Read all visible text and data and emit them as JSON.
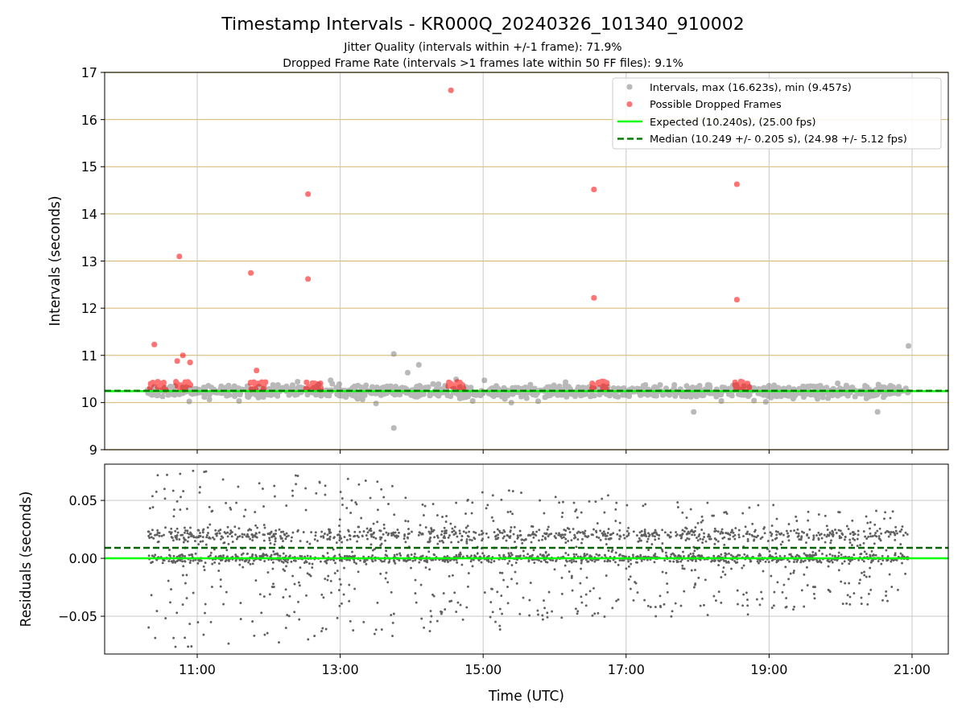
{
  "figure": {
    "title": "Timestamp Intervals - KR000Q_20240326_101340_910002",
    "subtitles": [
      "Jitter Quality (intervals within +/-1 frame): 71.9%",
      "Dropped Frame Rate (intervals >1 frames late within 50 FF files): 9.1%"
    ]
  },
  "charts": [
    {
      "chart_data": {
        "type": "scatter",
        "ylabel": "Intervals (seconds)",
        "xlim": [
          9.705,
          21.507
        ],
        "ylim": [
          9,
          17
        ],
        "yticks": [
          9,
          10,
          11,
          12,
          13,
          14,
          15,
          16,
          17
        ],
        "grid": true,
        "legend": true,
        "series": [
          {
            "name": "Intervals, max (16.623s), min (9.457s)",
            "type": "scatter",
            "color": "#808080",
            "x": [
              13.75,
              13.75,
              20.95,
              14.1
            ],
            "values": [
              11.03,
              9.46,
              11.2,
              10.8
            ]
          },
          {
            "name": "Possible Dropped Frames",
            "type": "scatter",
            "color": "#ff0000",
            "x": [
              10.4,
              10.75,
              11.75,
              12.55,
              12.55,
              14.55,
              16.55,
              16.55,
              18.55,
              18.55,
              10.8,
              10.9,
              10.72,
              11.83
            ],
            "values": [
              11.23,
              13.1,
              12.75,
              14.42,
              12.62,
              16.62,
              14.52,
              12.22,
              14.63,
              12.18,
              11.0,
              10.85,
              10.88,
              10.68
            ]
          },
          {
            "name": "Expected (10.240s), (25.00 fps)",
            "type": "line",
            "line_style": "solid",
            "color": "#00ff00",
            "x": [
              9.705,
              21.507
            ],
            "values": [
              10.24,
              10.24
            ]
          },
          {
            "name": "Median (10.249 +/- 0.205 s), (24.98 +/- 5.12 fps)",
            "type": "line",
            "line_style": "dashed",
            "color": "#008000",
            "x": [
              9.705,
              21.507
            ],
            "values": [
              10.25,
              10.25
            ]
          }
        ]
      }
    },
    {
      "chart_data": {
        "type": "scatter",
        "xlabel": "Time (UTC)",
        "ylabel": "Residuals (seconds)",
        "xlim": [
          9.705,
          21.507
        ],
        "ylim": [
          -0.0826,
          0.0813
        ],
        "grid": true,
        "xticks": [
          {
            "value": 11,
            "label": "11:00"
          },
          {
            "value": 13,
            "label": "13:00"
          },
          {
            "value": 15,
            "label": "15:00"
          },
          {
            "value": 17,
            "label": "17:00"
          },
          {
            "value": 19,
            "label": "19:00"
          },
          {
            "value": 21,
            "label": "21:00"
          }
        ],
        "yticks": [
          {
            "value": 0.05,
            "label": "0.05"
          },
          {
            "value": 0,
            "label": "0.00"
          },
          {
            "value": -0.05,
            "label": "−0.05"
          }
        ],
        "series": [
          {
            "type": "line",
            "line_style": "solid",
            "color": "#00ff00",
            "x": [
              9.705,
              21.507
            ],
            "values": [
              0,
              0
            ]
          },
          {
            "type": "line",
            "line_style": "dashed",
            "color": "#006400",
            "x": [
              9.705,
              21.507
            ],
            "values": [
              0.009,
              0.009
            ]
          }
        ]
      }
    }
  ]
}
